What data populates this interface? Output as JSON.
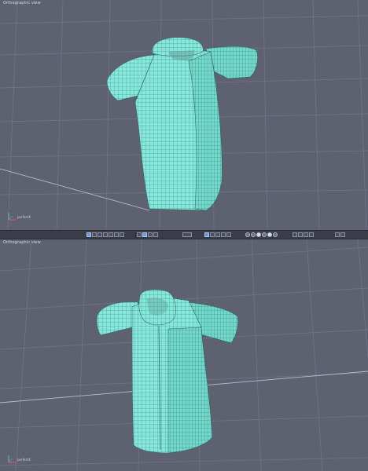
{
  "top_view": {
    "label": "Orthographic view",
    "axis_label": "perfectX"
  },
  "bottom_view": {
    "label": "Orthographic view",
    "axis_label": "perfectX"
  },
  "toolbar": {
    "groups": [
      {
        "name": "layout-buttons",
        "count": 7
      },
      {
        "name": "display-mode-buttons",
        "count": 4
      },
      {
        "name": "zoom-selector",
        "count": 1
      },
      {
        "name": "transform-tools",
        "count": 5
      },
      {
        "name": "shading-spheres",
        "count": 6
      },
      {
        "name": "snap-tools",
        "count": 4
      },
      {
        "name": "render-buttons",
        "count": 2
      }
    ]
  },
  "colors": {
    "viewport_bg": "#5d6170",
    "grid_line": "#70748a",
    "mesh_fill": "#7fe3d8",
    "mesh_wire": "#2f6d6a",
    "toolbar_bg": "#3a3d48"
  }
}
